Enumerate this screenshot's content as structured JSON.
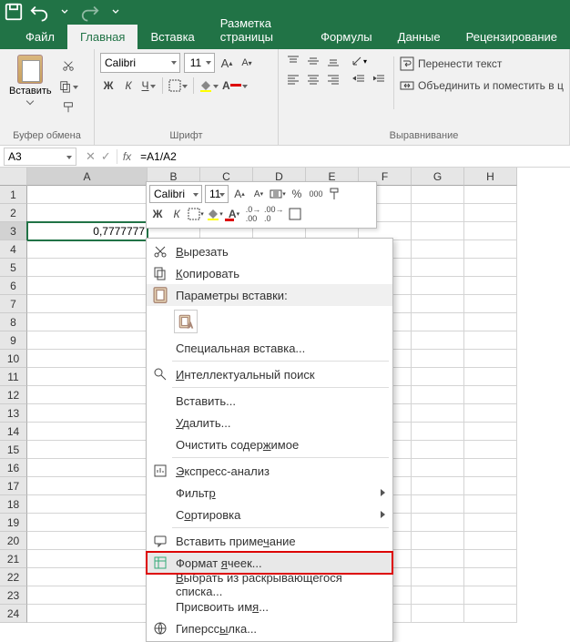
{
  "titlebar": {
    "save": "save-icon",
    "undo": "undo-icon",
    "redo": "redo-icon"
  },
  "tabs": {
    "file": "Файл",
    "home": "Главная",
    "insert": "Вставка",
    "layout": "Разметка страницы",
    "formulas": "Формулы",
    "data": "Данные",
    "review": "Рецензирование"
  },
  "ribbon": {
    "clipboard": {
      "paste": "Вставить",
      "group_label": "Буфер обмена"
    },
    "font": {
      "name": "Calibri",
      "size": "11",
      "bold": "Ж",
      "italic": "К",
      "underline": "Ч",
      "group_label": "Шрифт"
    },
    "alignment": {
      "wrap": "Перенести текст",
      "merge": "Объединить и поместить в ц",
      "group_label": "Выравнивание"
    }
  },
  "formula_bar": {
    "cell_ref": "A3",
    "fx": "fx",
    "formula": "=A1/A2"
  },
  "grid": {
    "columns": [
      "A",
      "B",
      "C",
      "D",
      "E",
      "F",
      "G",
      "H"
    ],
    "rows_visible": 24,
    "a3_value": "0,7777777"
  },
  "mini_toolbar": {
    "font": "Calibri",
    "size": "11",
    "bold": "Ж",
    "italic": "К",
    "percent": "%",
    "thousands": "000"
  },
  "context_menu": {
    "cut": "Вырезать",
    "copy": "Копировать",
    "paste_header": "Параметры вставки:",
    "paste_special": "Специальная вставка...",
    "smart_lookup": "Интеллектуальный поиск",
    "insert": "Вставить...",
    "delete": "Удалить...",
    "clear": "Очистить содержимое",
    "quick_analysis": "Экспресс-анализ",
    "filter": "Фильтр",
    "sort": "Сортировка",
    "insert_comment": "Вставить примечание",
    "format_cells": "Формат ячеек...",
    "dropdown_list": "Выбрать из раскрывающегося списка...",
    "define_name": "Присвоить имя...",
    "hyperlink": "Гиперссылка..."
  }
}
